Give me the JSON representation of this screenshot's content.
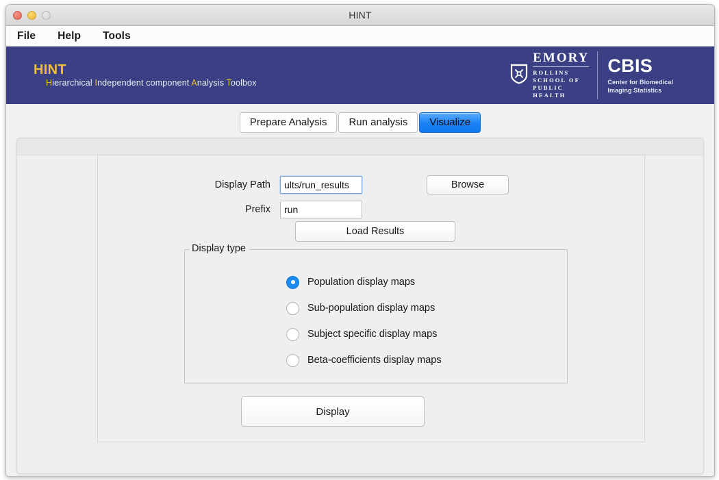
{
  "window": {
    "title": "HINT",
    "controls": {
      "close": "close-button",
      "minimize": "minimize-button",
      "zoom": "zoom-button"
    }
  },
  "menubar": {
    "items": [
      {
        "label": "File"
      },
      {
        "label": "Help"
      },
      {
        "label": "Tools"
      }
    ]
  },
  "brand": {
    "title": "HINT",
    "subtitle": {
      "part1_hl": "H",
      "part1": "ierarchical ",
      "part2_hl": "I",
      "part2": "ndependent  component ",
      "part3_hl": "A",
      "part3": "nalysis ",
      "part4_hl": "T",
      "part4": "oolbox"
    },
    "emory": {
      "shield_icon": "emory-shield-icon",
      "name": "EMORY",
      "line1": "ROLLINS",
      "line2": "SCHOOL OF",
      "line3": "PUBLIC",
      "line4": "HEALTH"
    },
    "cbis": {
      "name": "CBIS",
      "line1": "Center for Biomedical",
      "line2": "Imaging Statistics"
    },
    "header_color": "#3b4084",
    "accent_color": "#f0c033"
  },
  "tabs": [
    {
      "label": "Prepare Analysis",
      "active": false
    },
    {
      "label": "Run analysis",
      "active": false
    },
    {
      "label": "Visualize",
      "active": true
    }
  ],
  "form": {
    "display_path": {
      "label": "Display Path",
      "value": "ults/run_results",
      "placeholder": ""
    },
    "browse_button": "Browse",
    "prefix": {
      "label": "Prefix",
      "value": "run",
      "placeholder": ""
    },
    "load_results_button": "Load Results"
  },
  "display_type": {
    "legend": "Display type",
    "options": [
      {
        "label": "Population display maps",
        "selected": true
      },
      {
        "label": "Sub-population display maps",
        "selected": false
      },
      {
        "label": "Subject specific display maps",
        "selected": false
      },
      {
        "label": "Beta-coefficients display maps",
        "selected": false
      }
    ]
  },
  "display_button": "Display",
  "colors": {
    "active_tab": "#1d84f5",
    "radio_selected": "#1b8cf3",
    "window_chrome": "#f0f0f0"
  }
}
